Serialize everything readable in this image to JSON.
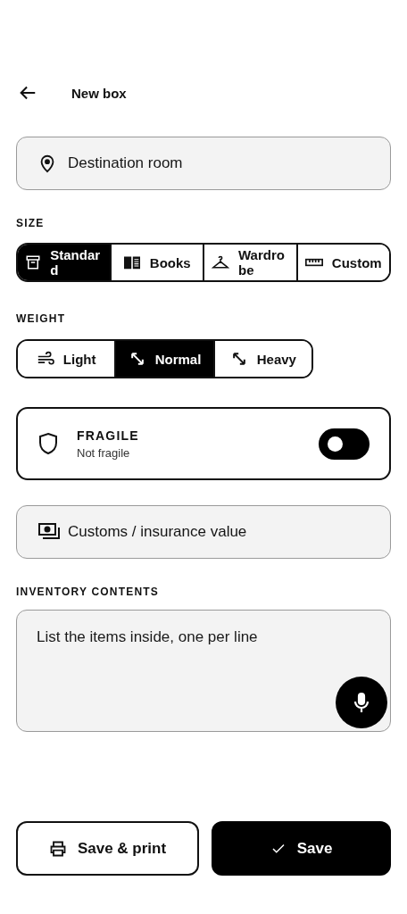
{
  "header": {
    "title": "New box"
  },
  "destination": {
    "placeholder": "Destination room"
  },
  "size": {
    "label": "SIZE",
    "options": [
      {
        "label": "Standard",
        "selected": true
      },
      {
        "label": "Books",
        "selected": false
      },
      {
        "label": "Wardrobe",
        "selected": false
      },
      {
        "label": "Custom",
        "selected": false
      }
    ]
  },
  "weight": {
    "label": "WEIGHT",
    "options": [
      {
        "label": "Light",
        "selected": false
      },
      {
        "label": "Normal",
        "selected": true
      },
      {
        "label": "Heavy",
        "selected": false
      }
    ]
  },
  "fragile": {
    "title": "FRAGILE",
    "subtitle": "Not fragile",
    "on": false
  },
  "value": {
    "placeholder": "Customs / insurance value"
  },
  "inventory": {
    "label": "INVENTORY CONTENTS",
    "placeholder": "List the items inside, one per line"
  },
  "actions": [
    {
      "label": "Save & print",
      "kind": "secondary"
    },
    {
      "label": "Save",
      "kind": "primary"
    }
  ]
}
